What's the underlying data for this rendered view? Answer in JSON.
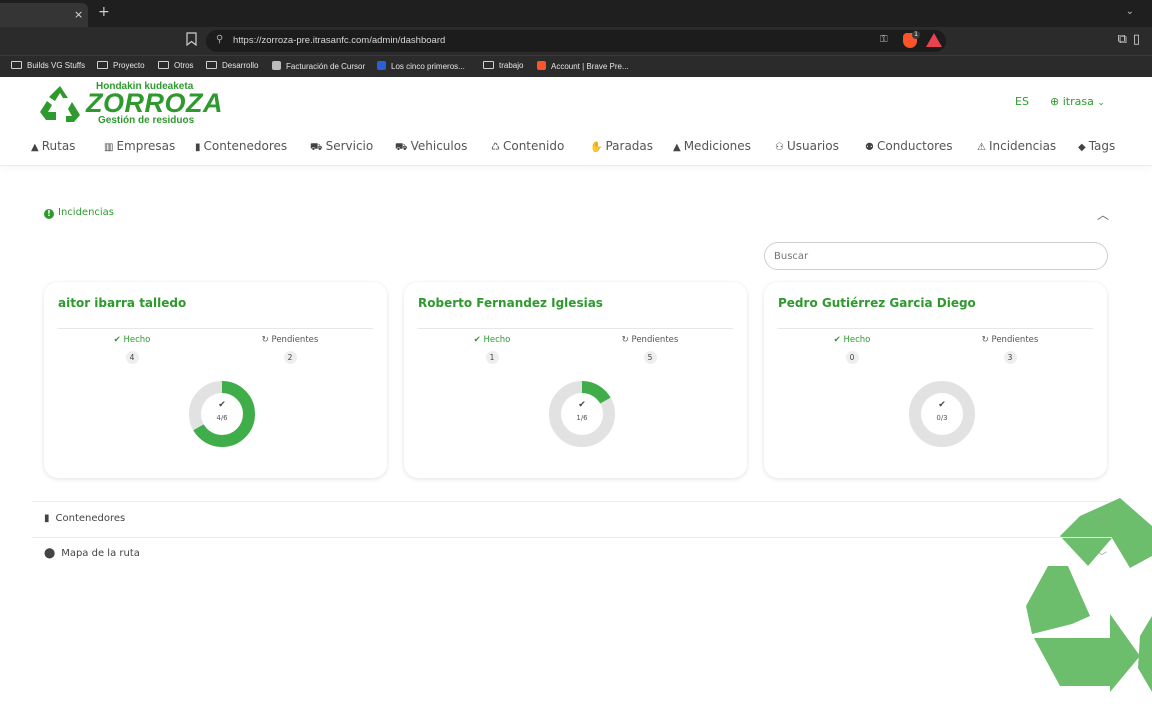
{
  "browser": {
    "tab": {
      "close": "×",
      "new": "+",
      "chevron": "⌄"
    },
    "url": "https://zorroza-pre.itrasanfc.com/admin/dashboard",
    "brave_badge": "1",
    "bookmarks": [
      {
        "label": "Builds VG Stuffs",
        "kind": "folder"
      },
      {
        "label": "Proyecto",
        "kind": "folder"
      },
      {
        "label": "Otros",
        "kind": "folder"
      },
      {
        "label": "Desarrollo",
        "kind": "folder"
      },
      {
        "label": "Facturación de Cursor",
        "kind": "site"
      },
      {
        "label": "Los cinco primeros...",
        "kind": "site"
      },
      {
        "label": "trabajo",
        "kind": "folder"
      },
      {
        "label": "Account | Brave Pre...",
        "kind": "site"
      }
    ]
  },
  "header": {
    "logo_top": "Hondakin kudeaketa",
    "logo_main": "ZORROZA",
    "logo_bottom": "Gestión de residuos",
    "lang": "ES",
    "user": "itrasa",
    "user_chevron": "⌄"
  },
  "nav": [
    {
      "label": "Rutas",
      "icon": "road-icon"
    },
    {
      "label": "Empresas",
      "icon": "building-icon"
    },
    {
      "label": "Contenedores",
      "icon": "trash-icon"
    },
    {
      "label": "Servicio",
      "icon": "truck-loading-icon"
    },
    {
      "label": "Vehiculos",
      "icon": "truck-icon"
    },
    {
      "label": "Contenido",
      "icon": "recycle-icon"
    },
    {
      "label": "Paradas",
      "icon": "hand-icon"
    },
    {
      "label": "Mediciones",
      "icon": "weight-icon"
    },
    {
      "label": "Usuarios",
      "icon": "users-icon"
    },
    {
      "label": "Conductores",
      "icon": "driver-icon"
    },
    {
      "label": "Incidencias",
      "icon": "warning-icon"
    },
    {
      "label": "Tags",
      "icon": "tags-icon"
    }
  ],
  "incidencias": {
    "title": "Incidencias",
    "search_placeholder": "Buscar",
    "done_label": "Hecho",
    "pending_label": "Pendientes",
    "cards": [
      {
        "name": "aitor ibarra talledo",
        "done": "4",
        "pending": "2",
        "progress": "4/6",
        "fraction": 0.6667
      },
      {
        "name": "Roberto Fernandez Iglesias",
        "done": "1",
        "pending": "5",
        "progress": "1/6",
        "fraction": 0.1667
      },
      {
        "name": "Pedro Gutiérrez Garcia Diego",
        "done": "0",
        "pending": "3",
        "progress": "0/3",
        "fraction": 0
      }
    ]
  },
  "sections": {
    "contenedores": "Contenedores",
    "mapa": "Mapa de la ruta"
  },
  "colors": {
    "brand": "#2e9a2e",
    "donut_fill": "#3fae4a",
    "donut_track": "#e2e2e2"
  }
}
